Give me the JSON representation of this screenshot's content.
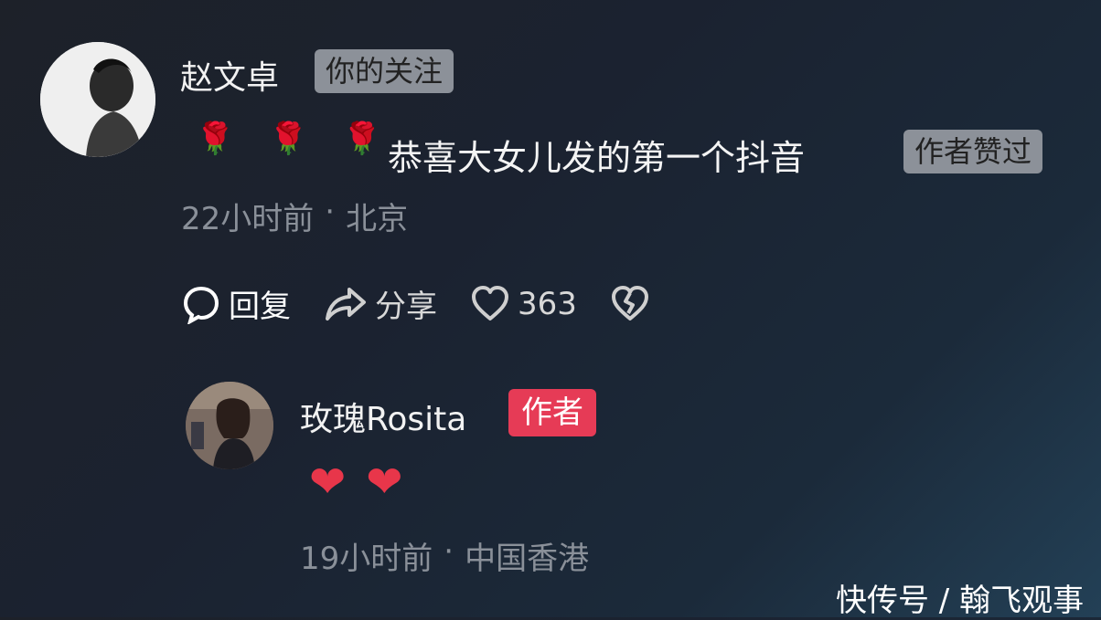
{
  "comment": {
    "username": "赵文卓",
    "relation_tag": "你的关注",
    "emoji": [
      "🌹",
      "🌹",
      "🌹"
    ],
    "text": "恭喜大女儿发的第一个抖音",
    "author_liked_tag": "作者赞过",
    "time": "22小时前",
    "location": "北京",
    "actions": {
      "reply_label": "回复",
      "share_label": "分享",
      "like_count": "363"
    }
  },
  "reply": {
    "username": "玫瑰Rosita",
    "author_tag": "作者",
    "emoji": [
      "❤",
      "❤"
    ],
    "time": "19小时前",
    "location": "中国香港"
  },
  "watermark": "快传号 / 翰飞观事",
  "icons": {
    "reply": "speech-bubble-icon",
    "share": "share-arrow-icon",
    "like": "heart-outline-icon",
    "dislike": "broken-heart-icon"
  },
  "colors": {
    "author_tag": "#e63b56",
    "gray_tag": "#8c9199",
    "meta_text": "#8a9099",
    "heart": "#e8364a"
  }
}
